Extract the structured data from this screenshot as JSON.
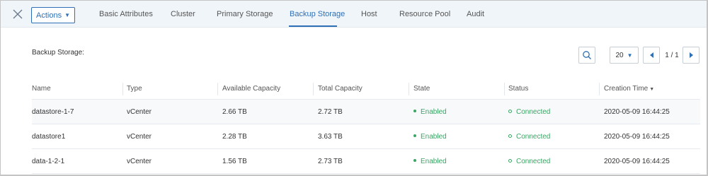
{
  "header": {
    "actions_label": "Actions",
    "tabs": [
      {
        "label": "Basic Attributes"
      },
      {
        "label": "Cluster"
      },
      {
        "label": "Primary Storage"
      },
      {
        "label": "Backup Storage",
        "active": true
      },
      {
        "label": "Host"
      },
      {
        "label": "Resource Pool"
      },
      {
        "label": "Audit"
      }
    ]
  },
  "section": {
    "label": "Backup Storage:"
  },
  "toolbar": {
    "search_icon": "search-icon",
    "page_size": "20",
    "page_indicator": "1 / 1"
  },
  "table": {
    "columns": [
      "Name",
      "Type",
      "Available Capacity",
      "Total Capacity",
      "State",
      "Status",
      "Creation Time"
    ],
    "rows": [
      {
        "name": "datastore-1-7",
        "type": "vCenter",
        "available": "2.66 TB",
        "total": "2.72 TB",
        "state": "Enabled",
        "status": "Connected",
        "created": "2020-05-09 16:44:25"
      },
      {
        "name": "datastore1",
        "type": "vCenter",
        "available": "2.28 TB",
        "total": "3.63 TB",
        "state": "Enabled",
        "status": "Connected",
        "created": "2020-05-09 16:44:25"
      },
      {
        "name": "data-1-2-1",
        "type": "vCenter",
        "available": "1.56 TB",
        "total": "2.73 TB",
        "state": "Enabled",
        "status": "Connected",
        "created": "2020-05-09 16:44:25"
      }
    ]
  },
  "colors": {
    "accent": "#2f6fb5",
    "success": "#3aa564",
    "header_bg": "#f0f5fa"
  }
}
